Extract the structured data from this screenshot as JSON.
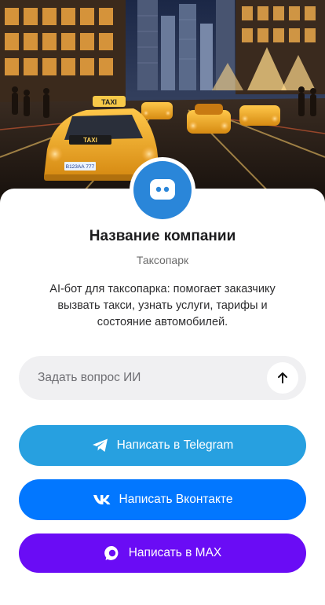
{
  "colors": {
    "avatar_bg": "#2a86d9",
    "telegram": "#27a0e0",
    "vk": "#0277ff",
    "max": "#6a0cf5",
    "input_bg": "#f0f0f2"
  },
  "hero": {
    "icon": "taxi-city-night-image",
    "taxi_sign": "TAXI",
    "plate": "В123АА 777"
  },
  "company": {
    "avatar_icon": "chat-bot-icon",
    "name": "Название компании",
    "type": "Таксопарк",
    "description": "AI-бот для таксопарка: помогает заказчику вызвать такси, узнать услуги, тарифы и состояние автомобилей."
  },
  "ask": {
    "placeholder": "Задать вопрос ИИ",
    "value": "",
    "send_icon": "arrow-up-icon"
  },
  "buttons": {
    "telegram": {
      "label": "Написать в Telegram",
      "icon": "telegram-icon"
    },
    "vk": {
      "label": "Написать Вконтакте",
      "icon": "vk-icon"
    },
    "max": {
      "label": "Написать в MAX",
      "icon": "max-icon"
    }
  }
}
